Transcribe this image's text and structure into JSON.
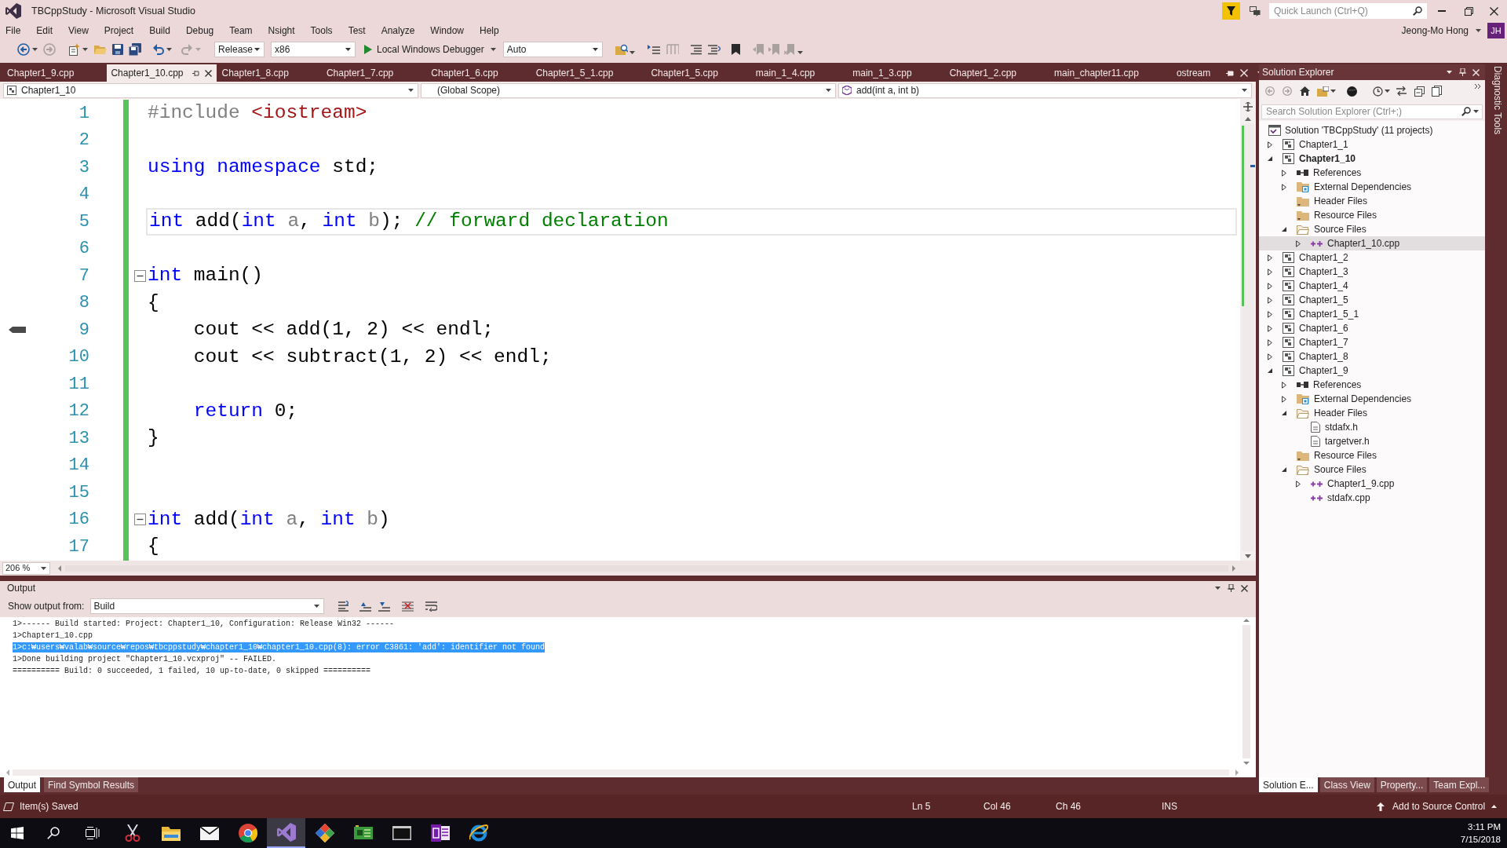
{
  "window": {
    "title": "TBCppStudy - Microsoft Visual Studio",
    "quick_launch": {
      "placeholder": "Quick Launch (Ctrl+Q)"
    }
  },
  "menu": [
    "File",
    "Edit",
    "View",
    "Project",
    "Build",
    "Debug",
    "Team",
    "Nsight",
    "Tools",
    "Test",
    "Analyze",
    "Window",
    "Help"
  ],
  "account": {
    "name": "Jeong-Mo Hong",
    "initials": "JH"
  },
  "toolbar": {
    "configuration": "Release",
    "platform": "x86",
    "debugger": "Local Windows Debugger",
    "mode": "Auto"
  },
  "tabs": [
    {
      "label": "Chapter1_9.cpp",
      "kind": "document",
      "selected": false
    },
    {
      "label": "Chapter1_10.cpp",
      "kind": "document",
      "selected": true
    },
    {
      "label": "Chapter1_8.cpp",
      "kind": "document",
      "selected": false
    },
    {
      "label": "Chapter1_7.cpp",
      "kind": "document",
      "selected": false
    },
    {
      "label": "Chapter1_6.cpp",
      "kind": "document",
      "selected": false
    },
    {
      "label": "Chapter1_5_1.cpp",
      "kind": "document",
      "selected": false
    },
    {
      "label": "Chapter1_5.cpp",
      "kind": "document",
      "selected": false
    },
    {
      "label": "main_1_4.cpp",
      "kind": "document",
      "selected": false
    },
    {
      "label": "main_1_3.cpp",
      "kind": "document",
      "selected": false
    },
    {
      "label": "Chapter1_2.cpp",
      "kind": "document",
      "selected": false
    },
    {
      "label": "main_chapter11.cpp",
      "kind": "document",
      "selected": false
    },
    {
      "label": "ostream",
      "kind": "preview",
      "selected": false
    }
  ],
  "navigation": {
    "project": "Chapter1_10",
    "scope": "(Global Scope)",
    "member": "add(int a, int b)"
  },
  "editor": {
    "zoom": "206 %",
    "lines": [
      {
        "number": "1",
        "changed": true,
        "current": false,
        "tokens": [
          {
            "text": "#include",
            "kind": "preprocessor"
          },
          {
            "text": " <iostream>",
            "kind": "string"
          }
        ]
      },
      {
        "number": "2",
        "changed": true,
        "current": false
      },
      {
        "number": "3",
        "changed": true,
        "current": false,
        "tokens": [
          {
            "text": "using namespace",
            "kind": "keyword"
          },
          {
            "text": " std;",
            "kind": "plain"
          }
        ]
      },
      {
        "number": "4",
        "changed": true,
        "current": false
      },
      {
        "number": "5",
        "changed": true,
        "current": true,
        "tokens": [
          {
            "text": "int",
            "kind": "keyword"
          },
          {
            "text": " add(",
            "kind": "plain"
          },
          {
            "text": "int",
            "kind": "keyword"
          },
          {
            "text": " a",
            "kind": "parameter"
          },
          {
            "text": ", ",
            "kind": "plain"
          },
          {
            "text": "int",
            "kind": "keyword"
          },
          {
            "text": " b",
            "kind": "parameter"
          },
          {
            "text": "); ",
            "kind": "plain"
          },
          {
            "text": "// forward declaration",
            "kind": "comment"
          }
        ]
      },
      {
        "number": "6",
        "changed": true,
        "current": false
      },
      {
        "number": "7",
        "changed": true,
        "current": false,
        "expanded": true,
        "tokens": [
          {
            "text": "int",
            "kind": "keyword"
          },
          {
            "text": " main()",
            "kind": "plain"
          }
        ]
      },
      {
        "number": "8",
        "changed": true,
        "current": false,
        "tokens": [
          {
            "text": "{",
            "kind": "plain"
          }
        ]
      },
      {
        "number": "9",
        "changed": true,
        "current": false,
        "margin_marker": true,
        "tokens": [
          {
            "text": "    cout << add(1, 2) << endl;",
            "kind": "plain"
          }
        ]
      },
      {
        "number": "10",
        "changed": true,
        "current": false,
        "tokens": [
          {
            "text": "    cout << subtract(1, 2) << endl;",
            "kind": "plain"
          }
        ]
      },
      {
        "number": "11",
        "changed": true,
        "current": false
      },
      {
        "number": "12",
        "changed": true,
        "current": false,
        "tokens": [
          {
            "text": "    return",
            "kind": "keyword"
          },
          {
            "text": " 0;",
            "kind": "plain"
          }
        ]
      },
      {
        "number": "13",
        "changed": true,
        "current": false,
        "tokens": [
          {
            "text": "}",
            "kind": "plain"
          }
        ]
      },
      {
        "number": "14",
        "changed": true,
        "current": false
      },
      {
        "number": "15",
        "changed": true,
        "current": false
      },
      {
        "number": "16",
        "changed": true,
        "current": false,
        "expanded": true,
        "tokens": [
          {
            "text": "int",
            "kind": "keyword"
          },
          {
            "text": " add(",
            "kind": "plain"
          },
          {
            "text": "int",
            "kind": "keyword"
          },
          {
            "text": " a",
            "kind": "parameter"
          },
          {
            "text": ", ",
            "kind": "plain"
          },
          {
            "text": "int",
            "kind": "keyword"
          },
          {
            "text": " b",
            "kind": "parameter"
          },
          {
            "text": ")",
            "kind": "plain"
          }
        ]
      },
      {
        "number": "17",
        "changed": true,
        "current": false,
        "tokens": [
          {
            "text": "{",
            "kind": "plain"
          }
        ]
      }
    ]
  },
  "output": {
    "title": "Output",
    "source_label": "Show output from:",
    "source": "Build",
    "lines": [
      {
        "text": "1>------ Build started: Project: Chapter1_10, Configuration: Release Win32 ------",
        "selected": false
      },
      {
        "text": "1>Chapter1_10.cpp",
        "selected": false
      },
      {
        "text": "1>c:₩users₩valab₩source₩repos₩tbcppstudy₩chapter1_10₩chapter1_10.cpp(8): error C3861: 'add': identifier not found",
        "selected": true
      },
      {
        "text": "1>Done building project \"Chapter1_10.vcxproj\" -- FAILED.",
        "selected": false
      },
      {
        "text": "========== Build: 0 succeeded, 1 failed, 10 up-to-date, 0 skipped ==========",
        "selected": false
      }
    ],
    "tabs": [
      {
        "label": "Output",
        "selected": true
      },
      {
        "label": "Find Symbol Results",
        "selected": false
      }
    ]
  },
  "solution_explorer": {
    "title": "Solution Explorer",
    "search": {
      "placeholder": "Search Solution Explorer (Ctrl+;)"
    },
    "tree": [
      {
        "label": "Solution 'TBCppStudy' (11 projects)",
        "kind": "solution",
        "selected": false,
        "children": [
          {
            "label": "Chapter1_1",
            "kind": "project",
            "expanded": false,
            "selected": false
          },
          {
            "label": "Chapter1_10",
            "kind": "project",
            "expanded": true,
            "startup": true,
            "selected": false,
            "children": [
              {
                "label": "References",
                "kind": "references",
                "expanded": false,
                "selected": false
              },
              {
                "label": "External Dependencies",
                "kind": "dependencies",
                "expanded": false,
                "selected": false
              },
              {
                "label": "Header Files",
                "kind": "folder",
                "selected": false
              },
              {
                "label": "Resource Files",
                "kind": "folder",
                "selected": false
              },
              {
                "label": "Source Files",
                "kind": "folder",
                "expanded": true,
                "selected": false,
                "children": [
                  {
                    "label": "Chapter1_10.cpp",
                    "kind": "source",
                    "expanded": false,
                    "selected": true
                  }
                ]
              }
            ]
          },
          {
            "label": "Chapter1_2",
            "kind": "project",
            "expanded": false,
            "selected": false
          },
          {
            "label": "Chapter1_3",
            "kind": "project",
            "expanded": false,
            "selected": false
          },
          {
            "label": "Chapter1_4",
            "kind": "project",
            "expanded": false,
            "selected": false
          },
          {
            "label": "Chapter1_5",
            "kind": "project",
            "expanded": false,
            "selected": false
          },
          {
            "label": "Chapter1_5_1",
            "kind": "project",
            "expanded": false,
            "selected": false
          },
          {
            "label": "Chapter1_6",
            "kind": "project",
            "expanded": false,
            "selected": false
          },
          {
            "label": "Chapter1_7",
            "kind": "project",
            "expanded": false,
            "selected": false
          },
          {
            "label": "Chapter1_8",
            "kind": "project",
            "expanded": false,
            "selected": false
          },
          {
            "label": "Chapter1_9",
            "kind": "project",
            "expanded": true,
            "selected": false,
            "children": [
              {
                "label": "References",
                "kind": "references",
                "expanded": false,
                "selected": false
              },
              {
                "label": "External Dependencies",
                "kind": "dependencies",
                "expanded": false,
                "selected": false
              },
              {
                "label": "Header Files",
                "kind": "folder",
                "expanded": true,
                "selected": false,
                "children": [
                  {
                    "label": "stdafx.h",
                    "kind": "header",
                    "selected": false
                  },
                  {
                    "label": "targetver.h",
                    "kind": "header",
                    "selected": false
                  }
                ]
              },
              {
                "label": "Resource Files",
                "kind": "folder",
                "selected": false
              },
              {
                "label": "Source Files",
                "kind": "folder",
                "expanded": true,
                "selected": false,
                "children": [
                  {
                    "label": "Chapter1_9.cpp",
                    "kind": "source",
                    "expanded": false,
                    "selected": false
                  },
                  {
                    "label": "stdafx.cpp",
                    "kind": "source",
                    "selected": false
                  }
                ]
              }
            ]
          }
        ]
      }
    ],
    "tabs": [
      {
        "label": "Solution E...",
        "selected": true
      },
      {
        "label": "Class View",
        "selected": false
      },
      {
        "label": "Property...",
        "selected": false
      },
      {
        "label": "Team Expl...",
        "selected": false
      }
    ]
  },
  "side_panel": {
    "label": "Diagnostic Tools"
  },
  "status_bar": {
    "message": "Item(s) Saved",
    "line": "Ln 5",
    "column": "Col 46",
    "char": "Ch 46",
    "mode": "INS",
    "source_control": "Add to Source Control"
  },
  "taskbar": {
    "apps": [
      {
        "selected": false
      },
      {
        "selected": false
      },
      {
        "selected": false
      },
      {
        "selected": false
      },
      {
        "selected": true
      },
      {
        "selected": false
      },
      {
        "selected": false
      },
      {
        "selected": false
      },
      {
        "selected": false
      },
      {
        "selected": false
      }
    ],
    "time": "3:11 PM",
    "date": "7/15/2018"
  }
}
